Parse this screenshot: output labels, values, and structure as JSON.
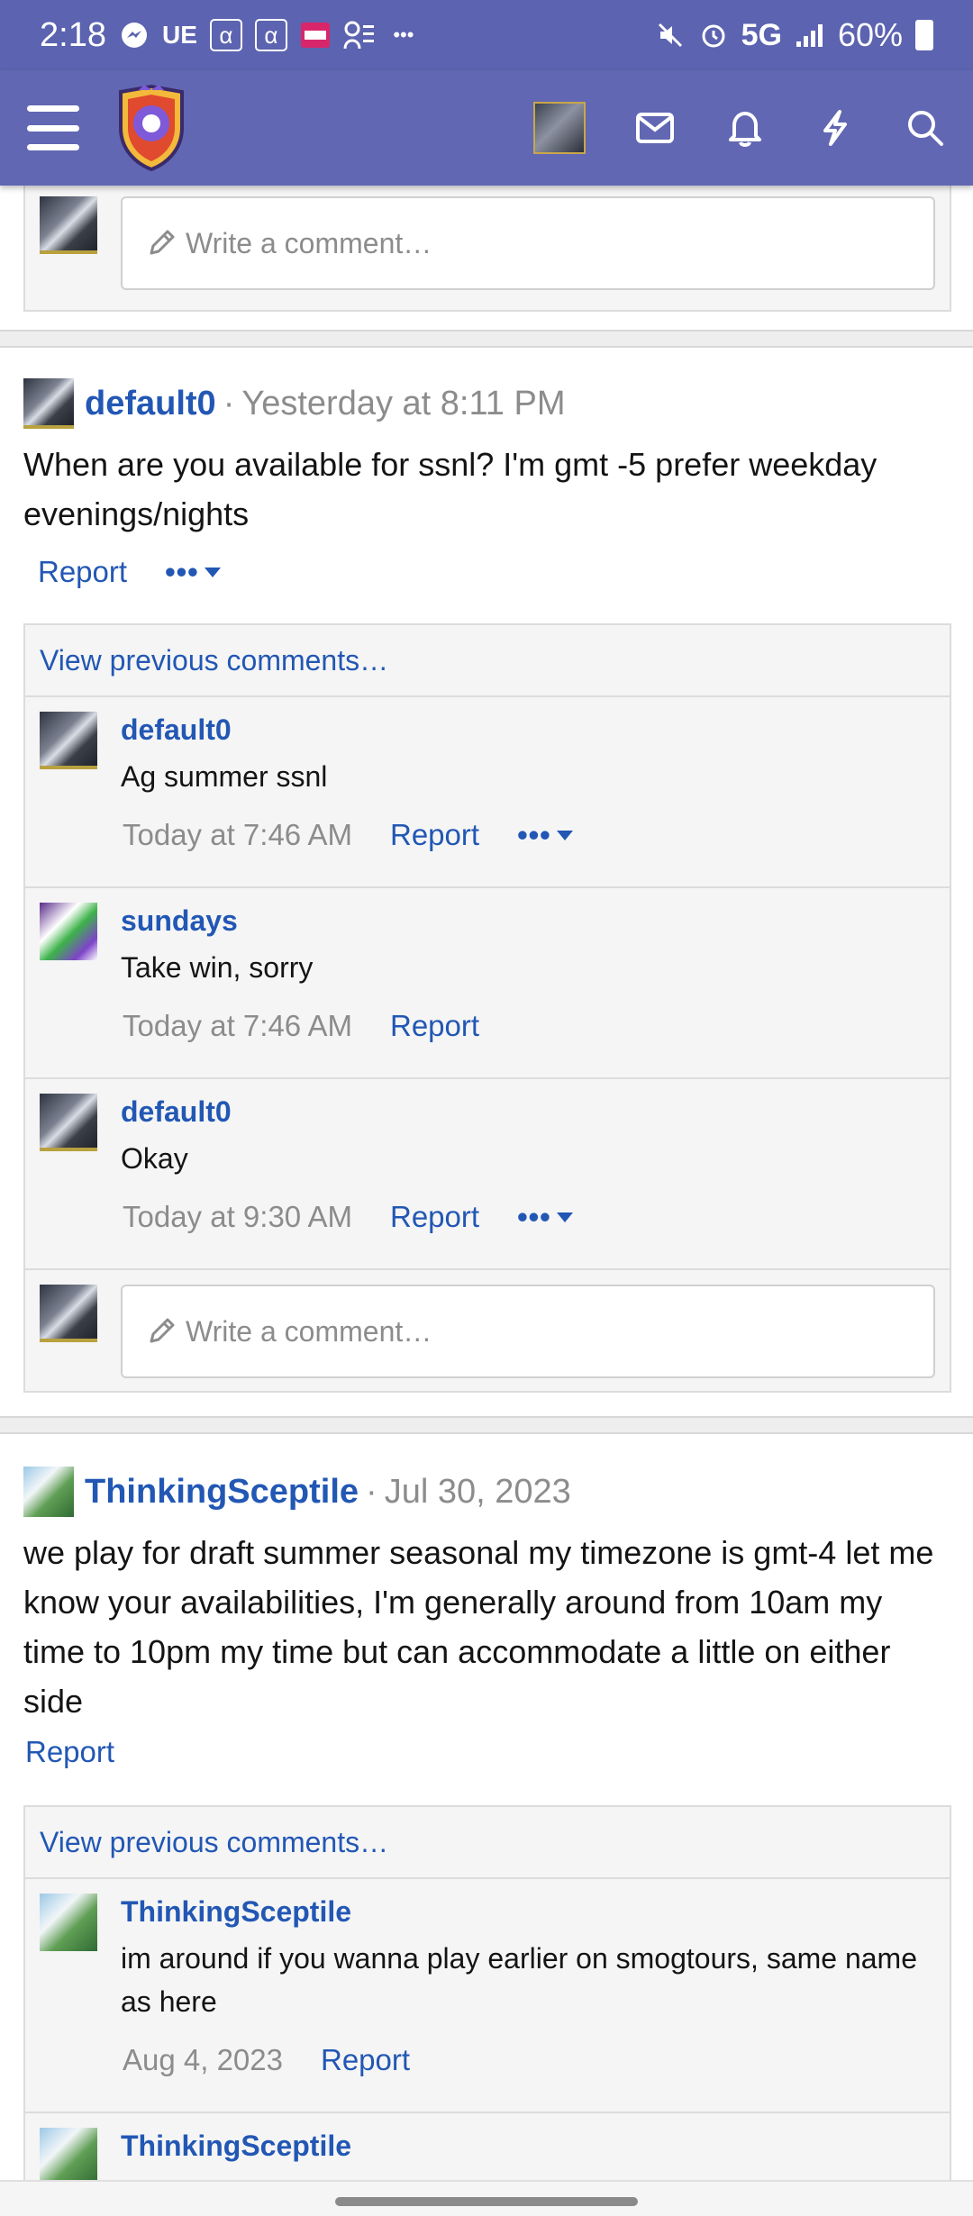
{
  "statusbar": {
    "time": "2:18",
    "carrier_tag": "UE",
    "network": "5G",
    "battery": "60%"
  },
  "navbar": {
    "icons": [
      "menu-icon",
      "mail-icon",
      "bell-icon",
      "lightning-icon",
      "search-icon"
    ]
  },
  "top_comment": {
    "placeholder": "Write a comment…"
  },
  "posts": [
    {
      "author": "default0",
      "time": "Yesterday at 8:11 PM",
      "text": "When are you available for ssnl? I'm gmt -5 prefer weekday evenings/nights",
      "report": "Report",
      "more": "•••",
      "view_previous": "View previous comments…",
      "replies": [
        {
          "author": "default0",
          "text": "Ag summer ssnl",
          "time": "Today at 7:46 AM",
          "report": "Report",
          "more": "•••"
        },
        {
          "author": "sundays",
          "text": "Take win, sorry",
          "time": "Today at 7:46 AM",
          "report": "Report"
        },
        {
          "author": "default0",
          "text": "Okay",
          "time": "Today at 9:30 AM",
          "report": "Report",
          "more": "•••"
        }
      ],
      "comment_placeholder": "Write a comment…"
    },
    {
      "author": "ThinkingSceptile",
      "time": "Jul 30, 2023",
      "text": "we play for draft summer seasonal my timezone is gmt-4 let me know your availabilities, I'm generally around from 10am my time to 10pm my time but can accommodate a little on either side",
      "report": "Report",
      "view_previous": "View previous comments…",
      "replies": [
        {
          "author": "ThinkingSceptile",
          "text": "im around if you wanna play earlier on smogtours, same name as here",
          "time": "Aug 4, 2023",
          "report": "Report"
        },
        {
          "author": "ThinkingSceptile"
        }
      ]
    }
  ]
}
